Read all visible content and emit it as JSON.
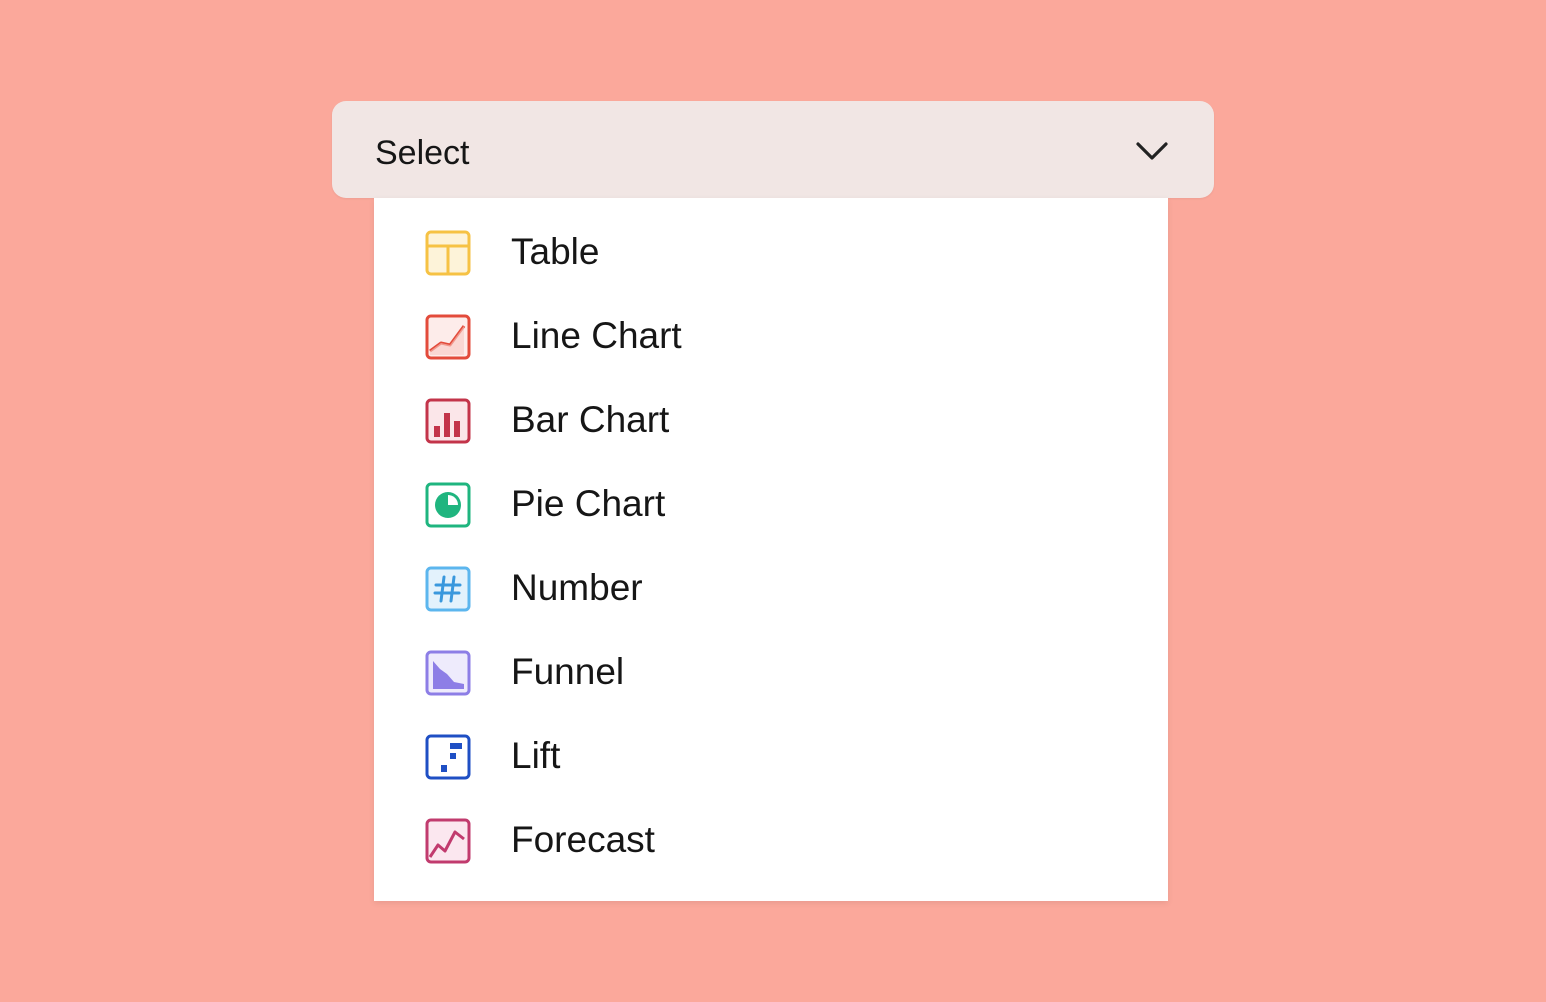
{
  "select": {
    "label": "Select",
    "chevron_icon": "chevron-down-icon"
  },
  "options": [
    {
      "label": "Table",
      "icon": "table-icon",
      "color": "#f6c244"
    },
    {
      "label": "Line Chart",
      "icon": "line-chart-icon",
      "color": "#e34b3b"
    },
    {
      "label": "Bar Chart",
      "icon": "bar-chart-icon",
      "color": "#c3344a"
    },
    {
      "label": "Pie Chart",
      "icon": "pie-chart-icon",
      "color": "#1fb57f"
    },
    {
      "label": "Number",
      "icon": "hash-icon",
      "color": "#5cb6ee"
    },
    {
      "label": "Funnel",
      "icon": "funnel-icon",
      "color": "#8d7ee6"
    },
    {
      "label": "Lift",
      "icon": "lift-icon",
      "color": "#1f4fc4"
    },
    {
      "label": "Forecast",
      "icon": "forecast-icon",
      "color": "#c13b6e"
    }
  ],
  "colors": {
    "background": "#fba89b",
    "select_bg": "#f1e6e4",
    "dropdown_bg": "#ffffff",
    "text": "#161616"
  }
}
